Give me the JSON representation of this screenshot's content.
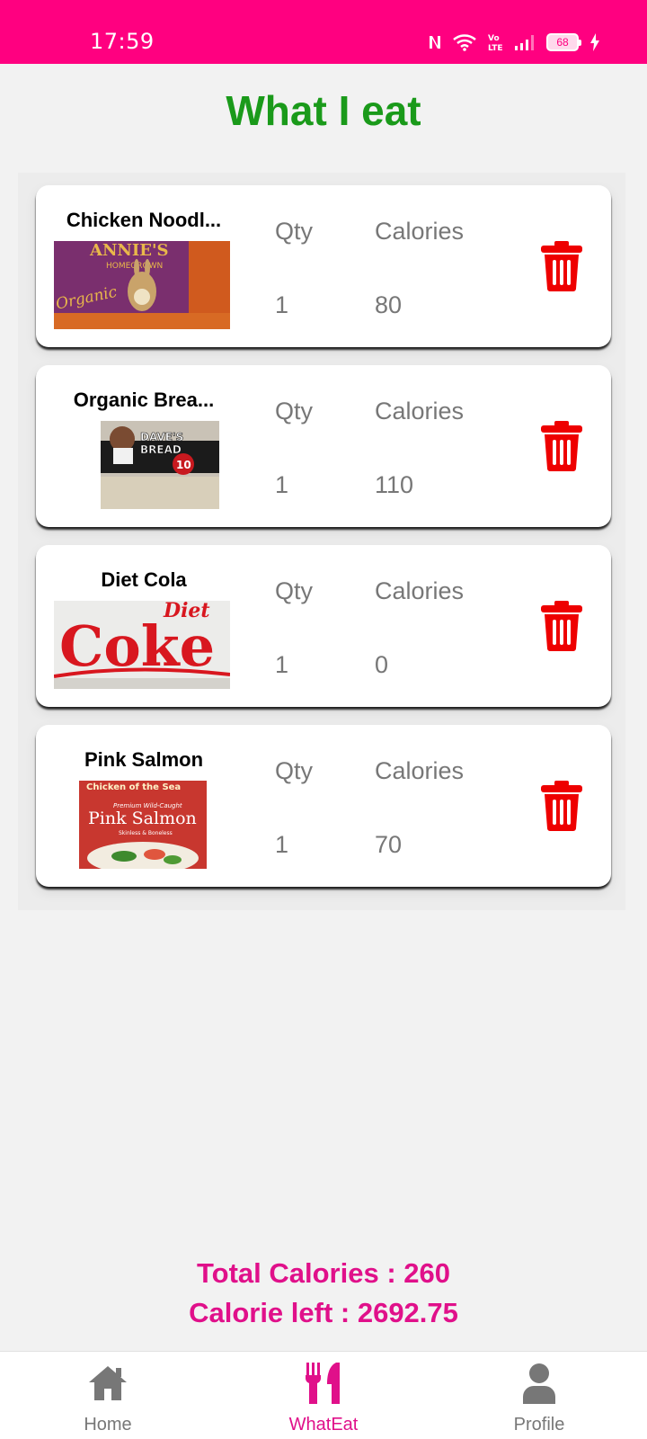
{
  "status_bar": {
    "time": "17:59",
    "battery_level": "68",
    "icons": [
      "nfc-icon",
      "wifi-icon",
      "volte-icon",
      "signal-icon",
      "battery-icon",
      "charging-icon"
    ]
  },
  "page": {
    "title": "What I eat"
  },
  "food_items": [
    {
      "name": "Chicken Noodl...",
      "qty_label": "Qty",
      "calories_label": "Calories",
      "qty": "1",
      "calories": "80"
    },
    {
      "name": "Organic Brea...",
      "qty_label": "Qty",
      "calories_label": "Calories",
      "qty": "1",
      "calories": "110"
    },
    {
      "name": "Diet Cola",
      "qty_label": "Qty",
      "calories_label": "Calories",
      "qty": "1",
      "calories": "0"
    },
    {
      "name": "Pink Salmon",
      "qty_label": "Qty",
      "calories_label": "Calories",
      "qty": "1",
      "calories": "70"
    }
  ],
  "thumbnails": {
    "chicken_noodle": {
      "brand": "ANNIE'S",
      "sub": "HOMEGROWN",
      "script": "Organic"
    },
    "bread": {
      "brand": "DAVE'S",
      "brand2": "BREAD",
      "badge": "10"
    },
    "cola": {
      "line1": "Diet",
      "line2": "Coke"
    },
    "salmon": {
      "brand": "Chicken of the Sea",
      "sub": "Premium Wild-Caught",
      "name": "Pink Salmon",
      "note": "Skinless & Boneless"
    }
  },
  "totals": {
    "total_calories": "Total Calories : 260",
    "calories_left": "Calorie left : 2692.75"
  },
  "nav": {
    "items": [
      {
        "label": "Home",
        "icon": "home-icon"
      },
      {
        "label": "WhatEat",
        "icon": "fork-knife-icon",
        "active": true
      },
      {
        "label": "Profile",
        "icon": "profile-icon"
      }
    ]
  },
  "colors": {
    "status_bar": "#ff0080",
    "title": "#1a9a1a",
    "accent": "#e0108a",
    "delete": "#ee0000",
    "label_gray": "#777777",
    "inactive_nav": "#777777"
  }
}
